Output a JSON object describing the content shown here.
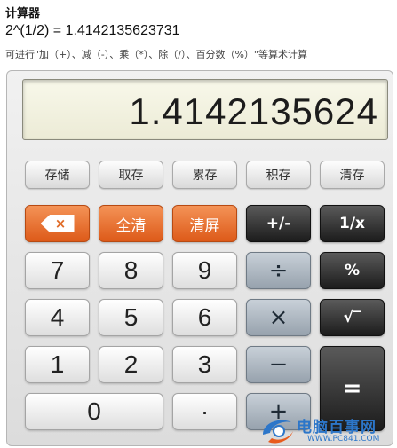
{
  "header": {
    "title": "计算器",
    "expression": "2^(1/2) = 1.4142135623731",
    "description": "可进行\"加（+）、减（-）、乘（*）、除（/）、百分数（%）\"等算术计算"
  },
  "display": {
    "value": "1.4142135624"
  },
  "memory_buttons": [
    "存储",
    "取存",
    "累存",
    "积存",
    "清存"
  ],
  "controls": {
    "backspace": "×",
    "all_clear": "全清",
    "clear_entry": "清屏"
  },
  "operators": {
    "plus_minus": "+/-",
    "reciprocal": "1/x",
    "divide": "÷",
    "percent": "%",
    "multiply": "×",
    "sqrt": "√‾",
    "minus": "−",
    "equals": "=",
    "plus": "+"
  },
  "digits": {
    "seven": "7",
    "eight": "8",
    "nine": "9",
    "four": "4",
    "five": "5",
    "six": "6",
    "one": "1",
    "two": "2",
    "three": "3",
    "zero": "0",
    "point": "·"
  },
  "watermark": {
    "text": "电脑百事网",
    "url": "WWW.PC841.COM"
  },
  "colors": {
    "orange": "#e0621e",
    "dark": "#2b2b2b",
    "gray_op": "#a7b1bb",
    "display_bg": "#f2f1de",
    "watermark": "#2c76c9"
  }
}
